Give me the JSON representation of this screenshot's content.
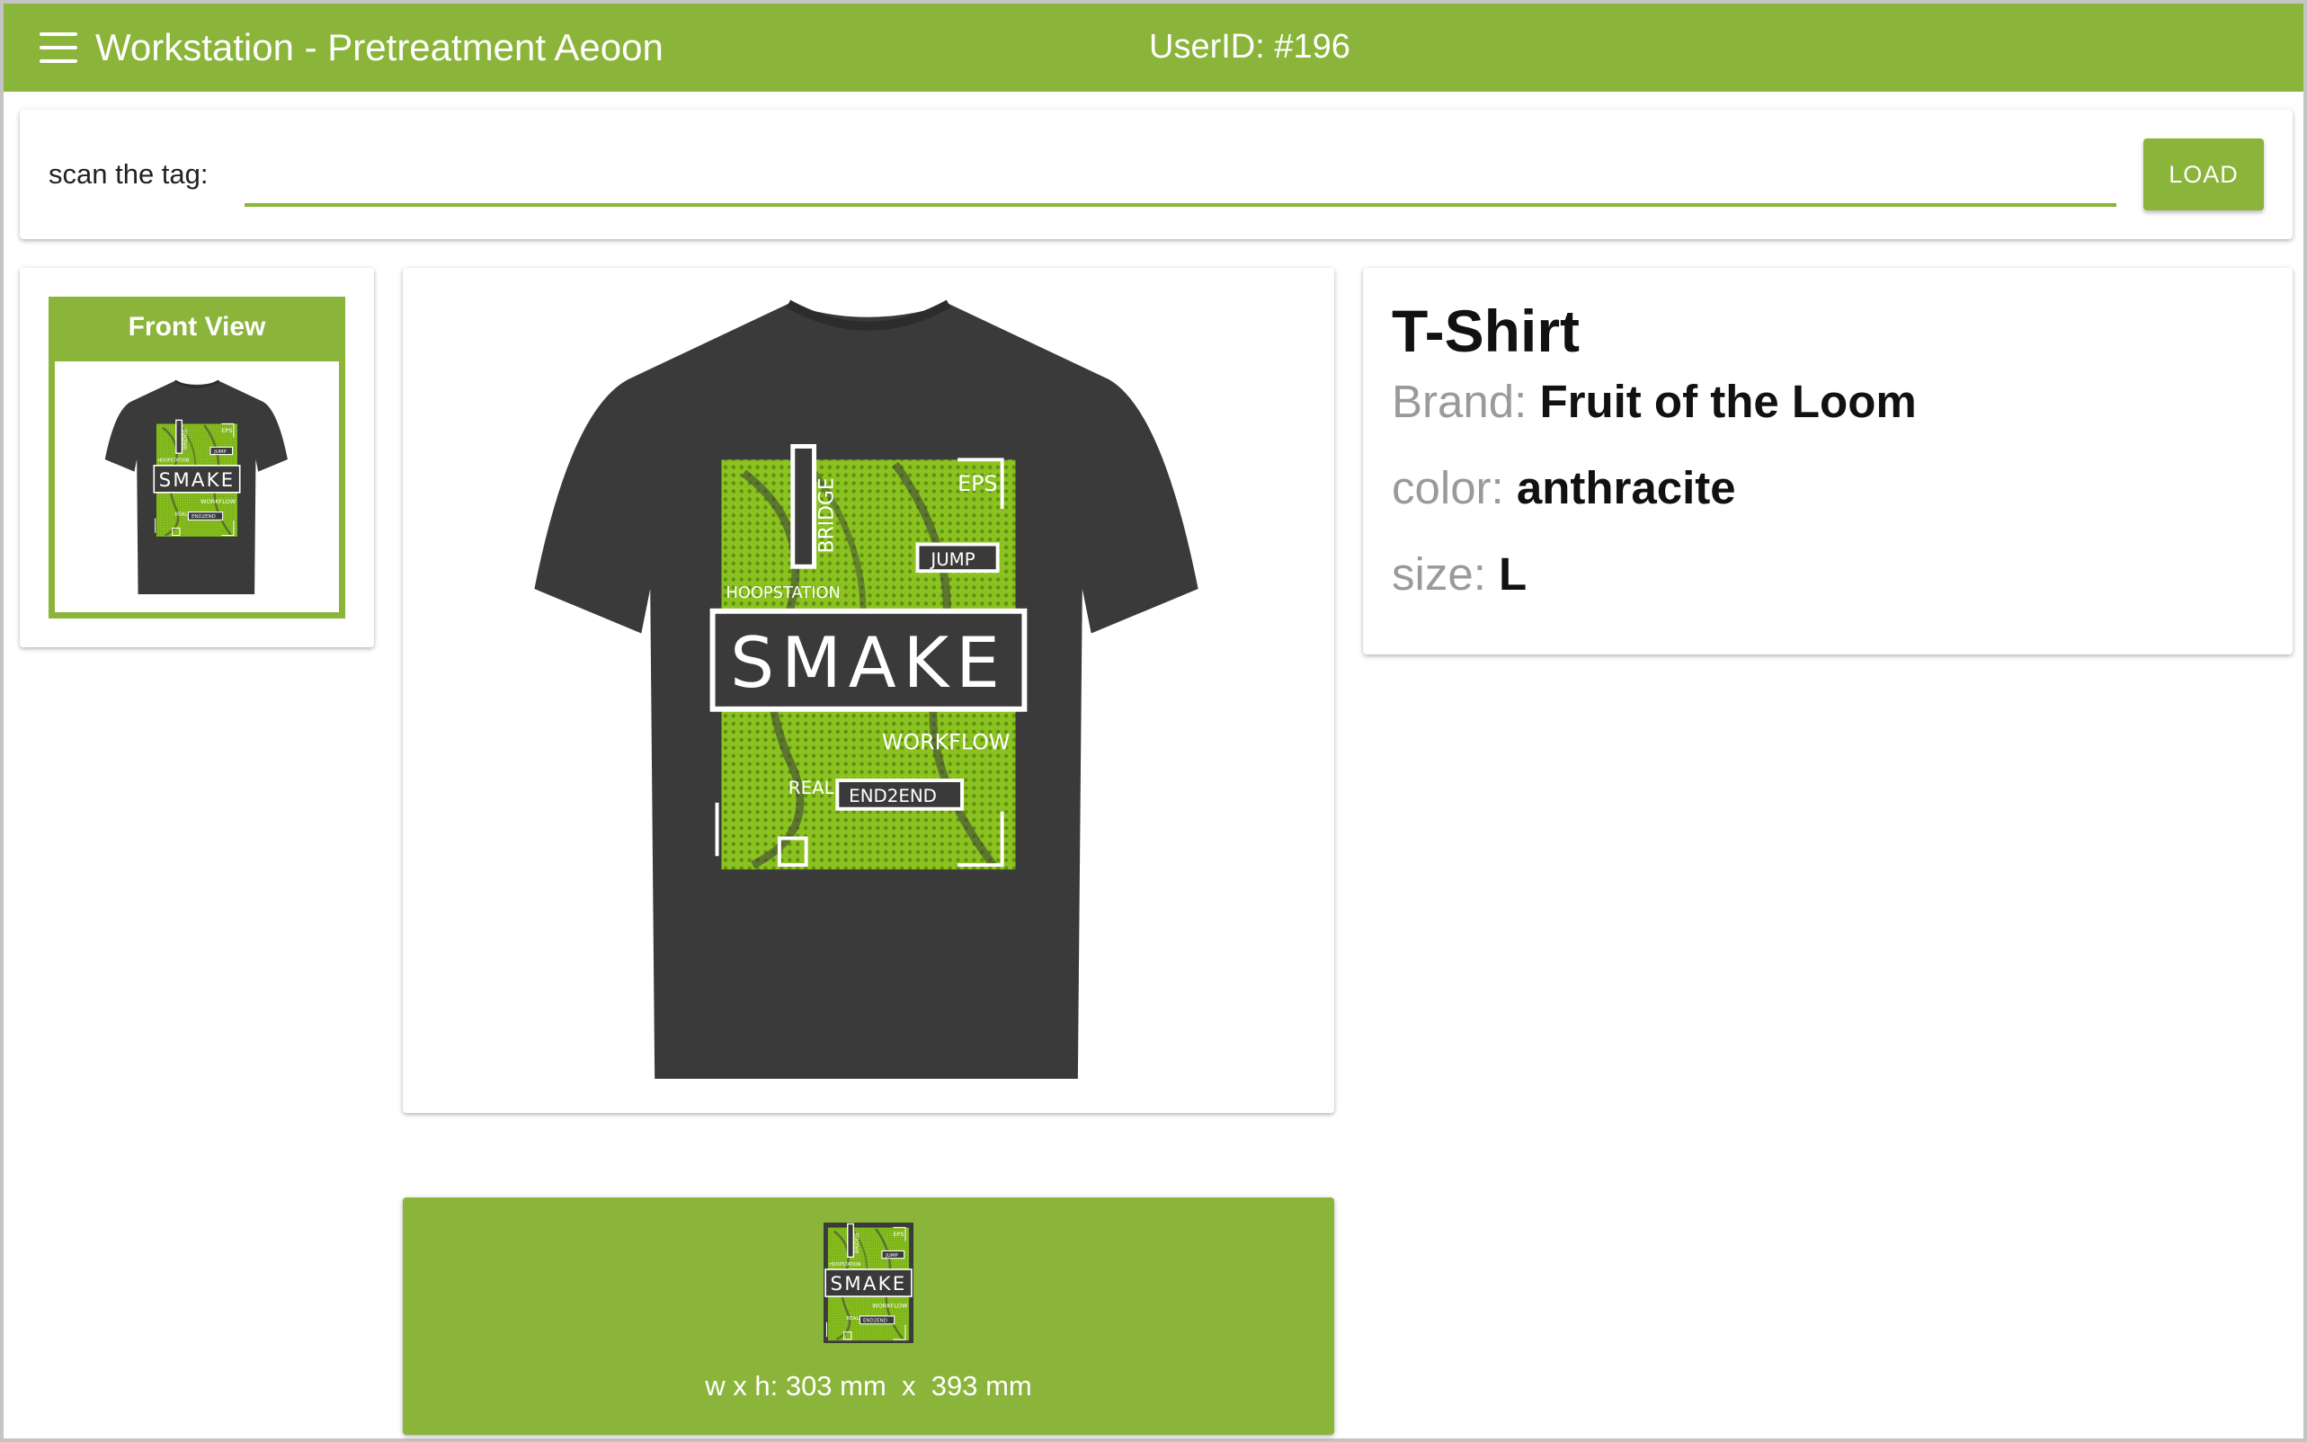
{
  "app": {
    "title": "Workstation - Pretreatment Aeoon",
    "user_id": "UserID: #196",
    "accent_color": "#8bb43a",
    "menu_icon": "hamburger-menu-icon"
  },
  "scan": {
    "label": "scan the tag:",
    "value": "",
    "placeholder": "",
    "button_label": "LOAD"
  },
  "views": [
    {
      "label": "Front View",
      "selected": true
    }
  ],
  "product": {
    "type": "T-Shirt",
    "brand_label": "Brand:",
    "brand": "Fruit of the Loom",
    "color_label": "color:",
    "color": "anthracite",
    "size_label": "size:",
    "size": "L"
  },
  "design": {
    "main_text": "SMAKE",
    "words": [
      "BRIDGE",
      "EPS",
      "JUMP",
      "HOOPSTATION",
      "WORKFLOW",
      "REAL",
      "END2END"
    ],
    "dimensions": "w x h: 303 mm  x  393 mm"
  }
}
